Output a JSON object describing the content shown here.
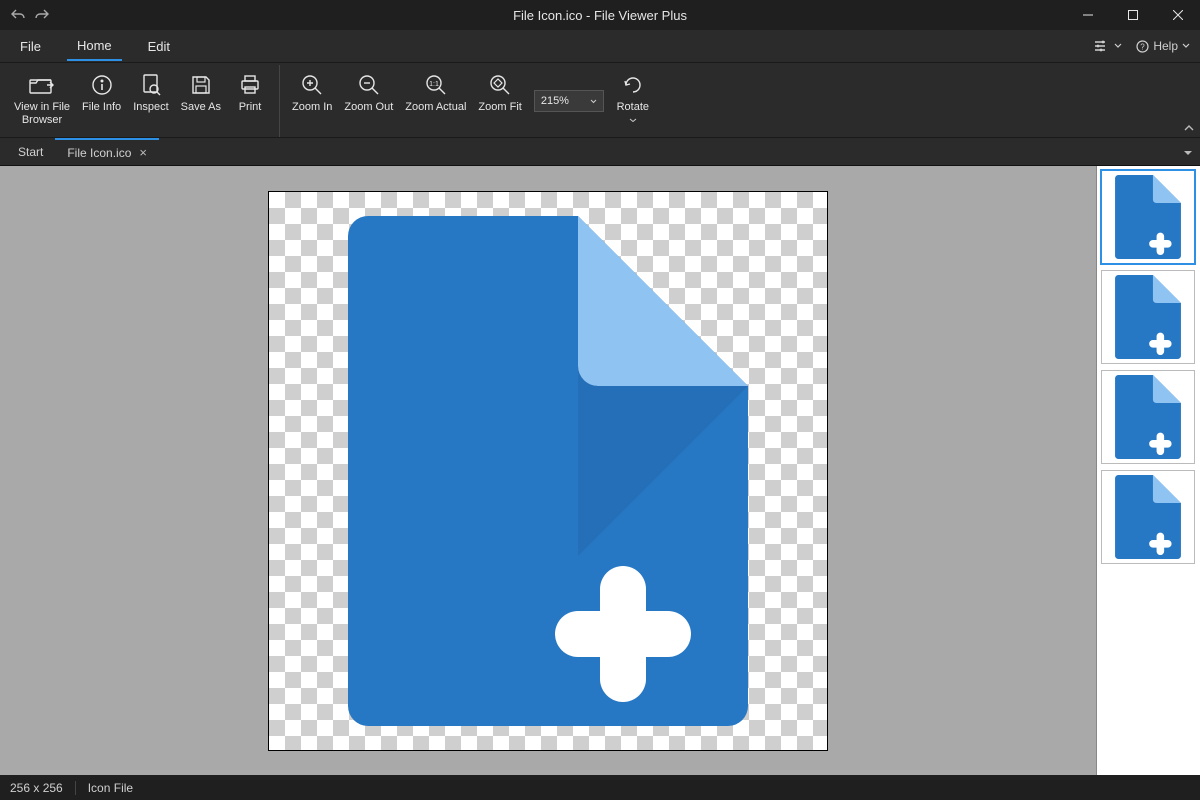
{
  "title": "File Icon.ico - File Viewer Plus",
  "menu": {
    "file": "File",
    "home": "Home",
    "edit": "Edit",
    "help": "Help"
  },
  "ribbon": {
    "view_in_file_browser": "View in File\nBrowser",
    "file_info": "File Info",
    "inspect": "Inspect",
    "save_as": "Save As",
    "print": "Print",
    "zoom_in": "Zoom In",
    "zoom_out": "Zoom Out",
    "zoom_actual": "Zoom Actual",
    "zoom_fit": "Zoom Fit",
    "zoom_value": "215%",
    "rotate": "Rotate"
  },
  "tabs": {
    "start": "Start",
    "file": "File Icon.ico"
  },
  "status": {
    "dimensions": "256 x 256",
    "type": "Icon File"
  },
  "colors": {
    "file_icon_main": "#2678c4",
    "file_icon_fold": "#8fc3f2",
    "file_icon_plus": "#ffffff"
  }
}
